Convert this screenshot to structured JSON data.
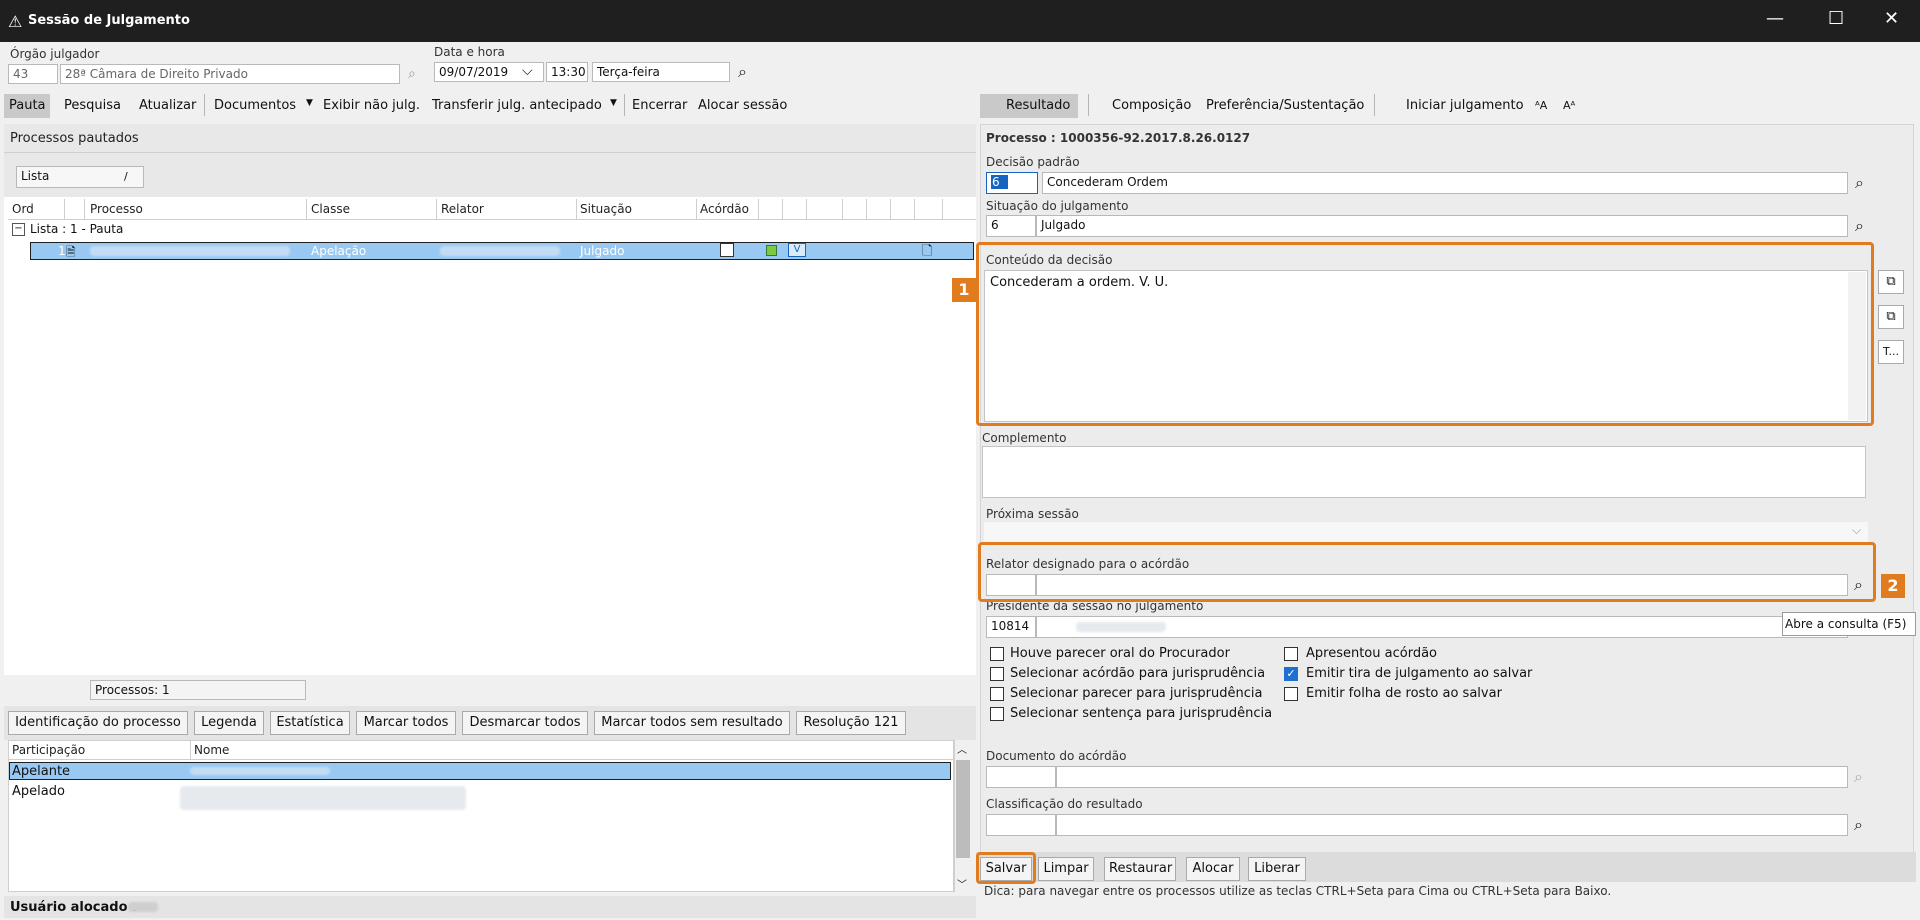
{
  "window": {
    "title": "Sessão de Julgamento",
    "minimize": "—",
    "maximize": "☐",
    "close": "✕"
  },
  "header": {
    "orgao_label": "Órgão julgador",
    "orgao_code": "43",
    "orgao_name": "28ª Câmara de Direito Privado",
    "data_label": "Data e hora",
    "date": "09/07/2019",
    "time": "13:30",
    "weekday": "Terça-feira"
  },
  "left_toolbar": {
    "items": [
      "Pauta",
      "Pesquisa",
      "Atualizar",
      "Documentos",
      "Exibir não julg.",
      "Transferir julg. antecipado",
      "Encerrar",
      "Alocar sessão"
    ]
  },
  "right_toolbar": {
    "items": [
      "Resultado",
      "Composição",
      "Preferência/Sustentação",
      "Iniciar julgamento"
    ],
    "font_up": "ᴬA",
    "font_down": "Aᴬ"
  },
  "left_panel": {
    "title": "Processos pautados",
    "view_select": "Lista",
    "columns": [
      "Ord",
      "Processo",
      "Classe",
      "Relator",
      "Situação",
      "Acórdão"
    ],
    "group_label": "Lista : 1 - Pauta",
    "row": {
      "ord": "1",
      "classe": "Apelação",
      "situacao": "Julgado"
    },
    "count": "Processos: 1",
    "buttons": [
      "Identificação do processo",
      "Legenda",
      "Estatística",
      "Marcar todos",
      "Desmarcar todos",
      "Marcar todos sem resultado",
      "Resolução 121"
    ],
    "part_columns": [
      "Participação",
      "Nome"
    ],
    "participants": [
      "Apelante",
      "Apelado"
    ],
    "usuario_label": "Usuário alocado :"
  },
  "right_panel": {
    "processo": "Processo : 1000356-92.2017.8.26.0127",
    "decisao_label": "Decisão padrão",
    "decisao_code": "6",
    "decisao_value": "Concederam Ordem",
    "situacao_label": "Situação do julgamento",
    "situacao_code": "6",
    "situacao_value": "Julgado",
    "conteudo_label": "Conteúdo da decisão",
    "conteudo_text": "Concederam a ordem. V. U.",
    "complemento_label": "Complemento",
    "proxima_label": "Próxima sessão",
    "relator_label": "Relator designado para o acórdão",
    "presidente_label": "Presidente da sessão no julgamento",
    "presidente_code": "10814",
    "tooltip": "Abre a consulta (F5)",
    "checks": [
      {
        "label": "Houve parecer oral do Procurador",
        "checked": false
      },
      {
        "label": "Selecionar acórdão para jurisprudência",
        "checked": false
      },
      {
        "label": "Selecionar parecer para jurisprudência",
        "checked": false
      },
      {
        "label": "Selecionar sentença para jurisprudência",
        "checked": false
      },
      {
        "label": "Apresentou acórdão",
        "checked": false
      },
      {
        "label": "Emitir tira de julgamento ao salvar",
        "checked": true
      },
      {
        "label": "Emitir folha de rosto ao salvar",
        "checked": false
      }
    ],
    "documento_label": "Documento do acórdão",
    "classificacao_label": "Classificação do resultado",
    "buttons": [
      "Salvar",
      "Limpar",
      "Restaurar",
      "Alocar",
      "Liberar"
    ],
    "tip": "Dica: para navegar entre os processos utilize as teclas CTRL+Seta para Cima ou CTRL+Seta para Baixo.",
    "side_t": "T..."
  },
  "annotations": {
    "badge1": "1",
    "badge2": "2"
  },
  "colors": {
    "accent_orange": "#e07b1e",
    "selection_blue": "#99c9f3",
    "titlebar": "#1f1f1f"
  }
}
